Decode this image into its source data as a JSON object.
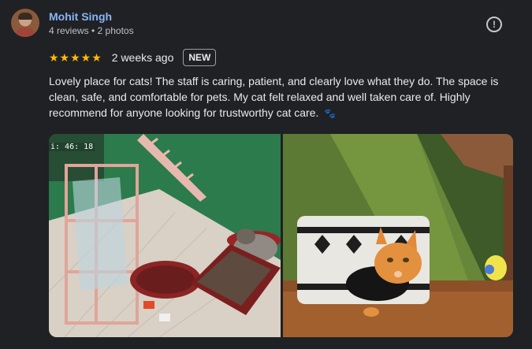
{
  "review": {
    "author": "Mohit Singh",
    "author_meta": "4 reviews • 2 photos",
    "stars": "★★★★★",
    "rating": 5,
    "date": "2 weeks ago",
    "badge": "NEW",
    "text": "Lovely place for cats! The staff is caring, patient, and clearly love what they do. The space is clean, safe, and comfortable for pets. My cat felt relaxed and well taken care of. Highly recommend for anyone looking for trustworthy cat care.",
    "emoji": "🐾"
  },
  "photos": {
    "photo1_timestamp": "i: 46: 18"
  },
  "icons": {
    "report": "report-flag-icon"
  },
  "colors": {
    "background": "#202124",
    "author_link": "#8ab4f8",
    "stars": "#fbbc04"
  }
}
